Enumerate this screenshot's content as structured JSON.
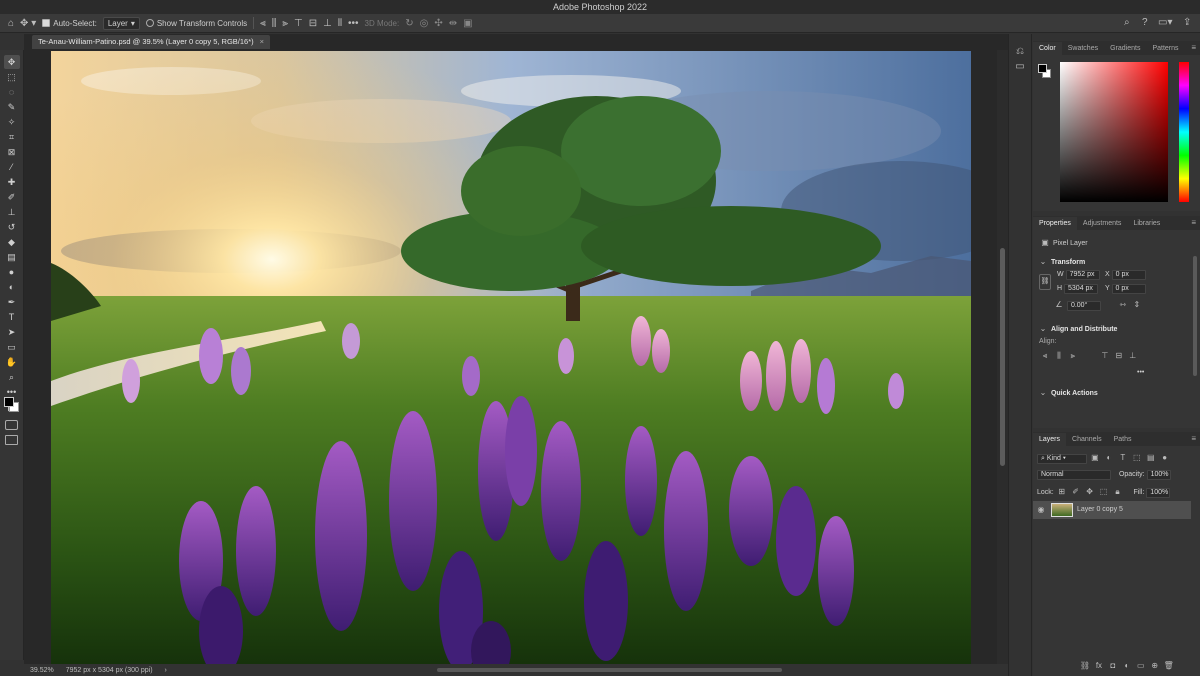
{
  "window": {
    "title": "Adobe Photoshop 2022"
  },
  "options_bar": {
    "auto_select_label": "Auto-Select:",
    "auto_select_value": "Layer",
    "show_transform_label": "Show Transform Controls",
    "mode_3d_label": "3D Mode:",
    "more_label": "•••"
  },
  "document": {
    "tab_title": "Te-Anau-William-Patino.psd @ 39.5% (Layer 0 copy 5, RGB/16*)",
    "close": "×"
  },
  "status": {
    "zoom": "39.52%",
    "dimensions": "7952 px x 5304 px (300 ppi)",
    "arrow": "›"
  },
  "color_panel": {
    "tabs": [
      "Color",
      "Swatches",
      "Gradients",
      "Patterns"
    ],
    "active_tab": "Color",
    "foreground": "#000000",
    "background": "#ffffff",
    "hue": "#ff0000"
  },
  "properties_panel": {
    "tabs": [
      "Properties",
      "Adjustments",
      "Libraries"
    ],
    "layer_type": "Pixel Layer",
    "transform_title": "Transform",
    "w_label": "W",
    "w_value": "7952 px",
    "h_label": "H",
    "h_value": "5304 px",
    "x_label": "X",
    "x_value": "0 px",
    "y_label": "Y",
    "y_value": "0 px",
    "angle_value": "0.00°",
    "align_title": "Align and Distribute",
    "align_label": "Align:",
    "more": "•••",
    "quick_actions_title": "Quick Actions"
  },
  "layers_panel": {
    "tabs": [
      "Layers",
      "Channels",
      "Paths"
    ],
    "filter_value": "Kind",
    "blend_mode": "Normal",
    "opacity_label": "Opacity:",
    "opacity_value": "100%",
    "lock_label": "Lock:",
    "fill_label": "Fill:",
    "fill_value": "100%",
    "layers": [
      {
        "name": "Layer 0 copy 5",
        "visible": true,
        "selected": true
      }
    ]
  }
}
